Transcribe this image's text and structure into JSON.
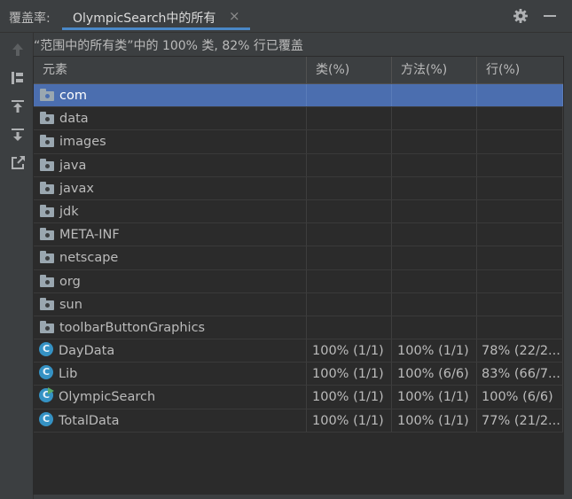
{
  "header": {
    "panel_title": "覆盖率:",
    "tab_label": "OlympicSearch中的所有",
    "tab_close": "×",
    "icons": [
      "gear-icon",
      "minimize-icon"
    ]
  },
  "left_toolbar": {
    "icons": [
      "arrow-up-icon",
      "flatten-packages-icon",
      "import-coverage-icon",
      "export-coverage-icon",
      "generate-report-icon"
    ]
  },
  "summary": {
    "text": "“范围中的所有类”中的 100% 类, 82% 行已覆盖"
  },
  "table": {
    "columns": [
      "元素",
      "类(%)",
      "方法(%)",
      "行(%)"
    ],
    "rows": [
      {
        "name": "com",
        "icon": "folder-icon",
        "cls": "",
        "method": "",
        "line": "",
        "selected": true
      },
      {
        "name": "data",
        "icon": "folder-icon",
        "cls": "",
        "method": "",
        "line": ""
      },
      {
        "name": "images",
        "icon": "folder-icon",
        "cls": "",
        "method": "",
        "line": ""
      },
      {
        "name": "java",
        "icon": "folder-icon",
        "cls": "",
        "method": "",
        "line": ""
      },
      {
        "name": "javax",
        "icon": "folder-icon",
        "cls": "",
        "method": "",
        "line": ""
      },
      {
        "name": "jdk",
        "icon": "folder-icon",
        "cls": "",
        "method": "",
        "line": ""
      },
      {
        "name": "META-INF",
        "icon": "folder-icon",
        "cls": "",
        "method": "",
        "line": ""
      },
      {
        "name": "netscape",
        "icon": "folder-icon",
        "cls": "",
        "method": "",
        "line": ""
      },
      {
        "name": "org",
        "icon": "folder-icon",
        "cls": "",
        "method": "",
        "line": ""
      },
      {
        "name": "sun",
        "icon": "folder-icon",
        "cls": "",
        "method": "",
        "line": ""
      },
      {
        "name": "toolbarButtonGraphics",
        "icon": "folder-icon",
        "cls": "",
        "method": "",
        "line": ""
      },
      {
        "name": "DayData",
        "icon": "class-icon",
        "cls": "100% (1/1)",
        "method": "100% (1/1)",
        "line": "78% (22/2..."
      },
      {
        "name": "Lib",
        "icon": "class-icon",
        "cls": "100% (1/1)",
        "method": "100% (6/6)",
        "line": "83% (66/7..."
      },
      {
        "name": "OlympicSearch",
        "icon": "runnable-class-icon",
        "cls": "100% (1/1)",
        "method": "100% (1/1)",
        "line": "100% (6/6)"
      },
      {
        "name": "TotalData",
        "icon": "class-icon",
        "cls": "100% (1/1)",
        "method": "100% (1/1)",
        "line": "77% (21/2..."
      }
    ]
  },
  "colors": {
    "background": "#3c3f41",
    "table_background": "#2b2b2b",
    "selection": "#4b6eaf",
    "accent_tab": "#4a88c7",
    "class_icon": "#3592c4"
  }
}
